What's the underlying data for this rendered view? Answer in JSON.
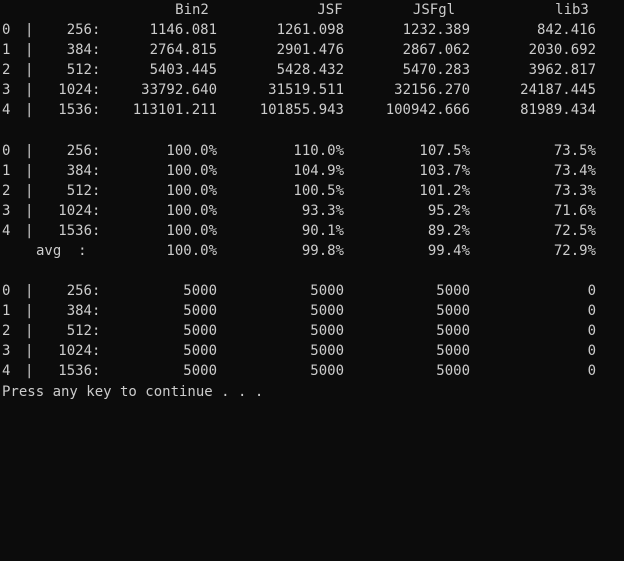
{
  "headers": [
    "Bin2",
    "JSF",
    "JSFgl",
    "lib3"
  ],
  "timing_rows": [
    {
      "index": "0",
      "sep": "|",
      "size": "256",
      "colon": ":",
      "values": [
        "1146.081",
        "1261.098",
        "1232.389",
        "842.416"
      ]
    },
    {
      "index": "1",
      "sep": "|",
      "size": "384",
      "colon": ":",
      "values": [
        "2764.815",
        "2901.476",
        "2867.062",
        "2030.692"
      ]
    },
    {
      "index": "2",
      "sep": "|",
      "size": "512",
      "colon": ":",
      "values": [
        "5403.445",
        "5428.432",
        "5470.283",
        "3962.817"
      ]
    },
    {
      "index": "3",
      "sep": "|",
      "size": "1024",
      "colon": ":",
      "values": [
        "33792.640",
        "31519.511",
        "32156.270",
        "24187.445"
      ]
    },
    {
      "index": "4",
      "sep": "|",
      "size": "1536",
      "colon": ":",
      "values": [
        "113101.211",
        "101855.943",
        "100942.666",
        "81989.434"
      ]
    }
  ],
  "percent_rows": [
    {
      "index": "0",
      "sep": "|",
      "size": "256",
      "colon": ":",
      "values": [
        "100.0%",
        "110.0%",
        "107.5%",
        "73.5%"
      ]
    },
    {
      "index": "1",
      "sep": "|",
      "size": "384",
      "colon": ":",
      "values": [
        "100.0%",
        "104.9%",
        "103.7%",
        "73.4%"
      ]
    },
    {
      "index": "2",
      "sep": "|",
      "size": "512",
      "colon": ":",
      "values": [
        "100.0%",
        "100.5%",
        "101.2%",
        "73.3%"
      ]
    },
    {
      "index": "3",
      "sep": "|",
      "size": "1024",
      "colon": ":",
      "values": [
        "100.0%",
        "93.3%",
        "95.2%",
        "71.6%"
      ]
    },
    {
      "index": "4",
      "sep": "|",
      "size": "1536",
      "colon": ":",
      "values": [
        "100.0%",
        "90.1%",
        "89.2%",
        "72.5%"
      ]
    }
  ],
  "avg_row": {
    "label": "avg  :",
    "values": [
      "100.0%",
      "99.8%",
      "99.4%",
      "72.9%"
    ]
  },
  "count_rows": [
    {
      "index": "0",
      "sep": "|",
      "size": "256",
      "colon": ":",
      "values": [
        "5000",
        "5000",
        "5000",
        "0"
      ]
    },
    {
      "index": "1",
      "sep": "|",
      "size": "384",
      "colon": ":",
      "values": [
        "5000",
        "5000",
        "5000",
        "0"
      ]
    },
    {
      "index": "2",
      "sep": "|",
      "size": "512",
      "colon": ":",
      "values": [
        "5000",
        "5000",
        "5000",
        "0"
      ]
    },
    {
      "index": "3",
      "sep": "|",
      "size": "1024",
      "colon": ":",
      "values": [
        "5000",
        "5000",
        "5000",
        "0"
      ]
    },
    {
      "index": "4",
      "sep": "|",
      "size": "1536",
      "colon": ":",
      "values": [
        "5000",
        "5000",
        "5000",
        "0"
      ]
    }
  ],
  "prompt": "Press any key to continue . . .",
  "colors": {
    "background": "#0c0c0c",
    "text": "#cccccc"
  }
}
